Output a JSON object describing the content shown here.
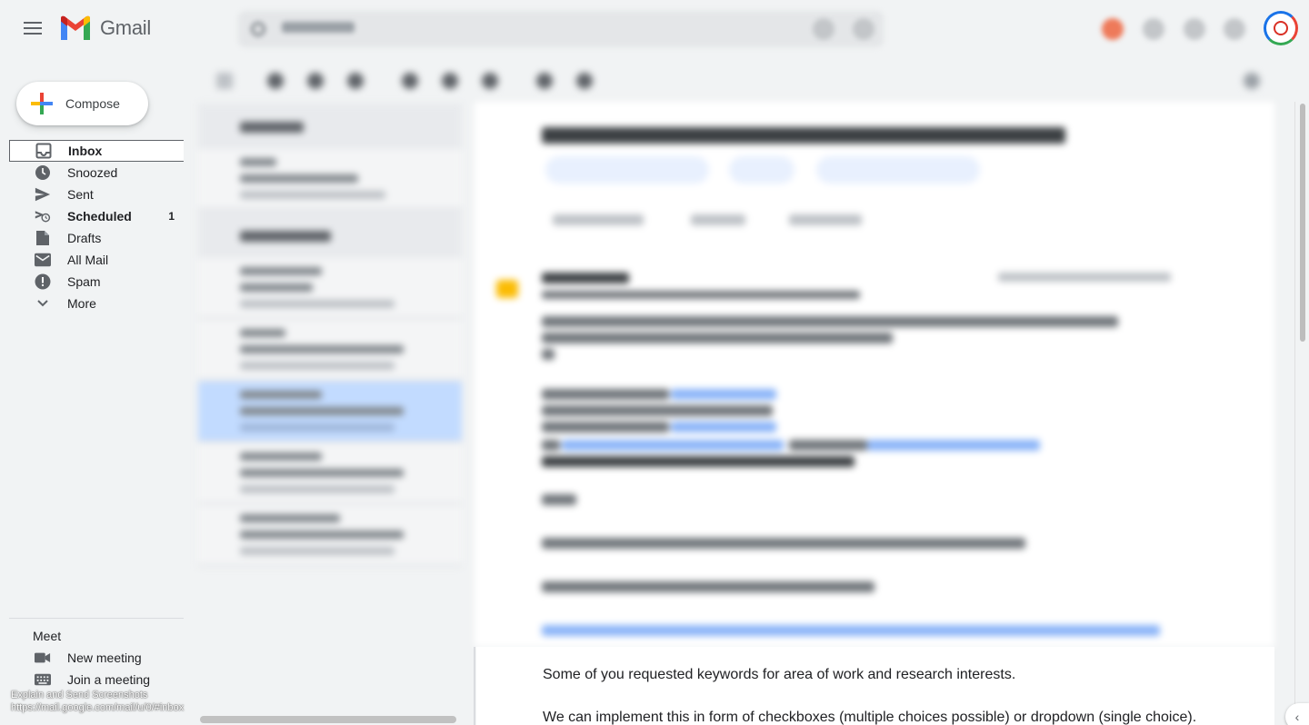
{
  "header": {
    "app_name": "Gmail",
    "search_value": "",
    "colors": {
      "brand_red": "#EA4335",
      "brand_blue": "#4285F4",
      "brand_green": "#34A853",
      "brand_yellow": "#FBBC04"
    }
  },
  "sidebar": {
    "compose_label": "Compose",
    "items": [
      {
        "label": "Inbox",
        "icon": "inbox-icon",
        "active": true,
        "count": ""
      },
      {
        "label": "Snoozed",
        "icon": "clock-icon",
        "count": ""
      },
      {
        "label": "Sent",
        "icon": "send-icon",
        "count": ""
      },
      {
        "label": "Scheduled",
        "icon": "scheduled-send-icon",
        "count": "1"
      },
      {
        "label": "Drafts",
        "icon": "draft-icon",
        "count": ""
      },
      {
        "label": "All Mail",
        "icon": "mail-icon",
        "count": ""
      },
      {
        "label": "Spam",
        "icon": "spam-icon",
        "count": ""
      },
      {
        "label": "More",
        "icon": "chevron-down-icon",
        "count": ""
      }
    ],
    "meet": {
      "title": "Meet",
      "new_meeting": "New meeting",
      "join_meeting": "Join a meeting"
    }
  },
  "status_overlay": {
    "line1": "Explain and Send Screenshots",
    "line2": "https://mail.google.com/mail/u/0/#inbox"
  },
  "email_body": {
    "line1": "Some of you requested keywords for area of work and research interests.",
    "line2": "We can implement this in form of checkboxes (multiple choices possible) or dropdown (single choice)."
  }
}
